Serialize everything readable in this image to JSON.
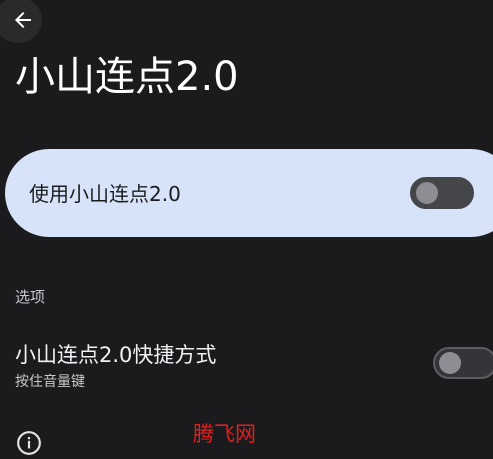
{
  "header": {
    "back_icon": "arrow-back-icon",
    "title": "小山连点2.0"
  },
  "main_switch": {
    "label": "使用小山连点2.0",
    "checked": false
  },
  "options_section": {
    "header": "选项",
    "items": [
      {
        "title": "小山连点2.0快捷方式",
        "summary": "按住音量键",
        "checked": false
      }
    ]
  },
  "footer": {
    "info_icon": "info-icon"
  },
  "watermark": {
    "text": "腾飞网"
  },
  "colors": {
    "background": "#1b1b1d",
    "card": "#d7e3f8",
    "watermark": "#e02020"
  }
}
